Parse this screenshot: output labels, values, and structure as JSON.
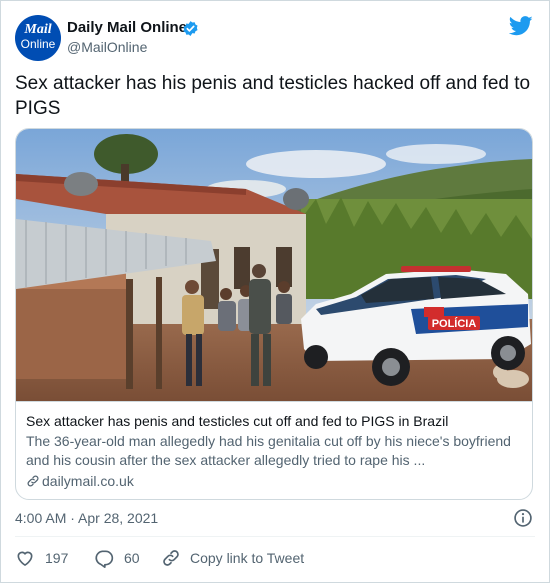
{
  "account": {
    "avatar_line1": "Mail",
    "avatar_line2": "Online",
    "name": "Daily Mail Online",
    "handle": "@MailOnline",
    "verified": true
  },
  "tweet": {
    "text": "Sex attacker has his penis and testicles hacked off and fed to PIGS",
    "timestamp": "4:00 AM · Apr 28, 2021"
  },
  "card": {
    "image_alt": "Police car parked outside a rural house with people standing on the veranda",
    "title": "Sex attacker has penis and testicles cut off and fed to PIGS in Brazil",
    "description": "The 36-year-old man allegedly had his genitalia cut off by his niece's boyfriend and his cousin after the sex attacker allegedly tried to rape his ...",
    "domain": "dailymail.co.uk",
    "police_text": "POLÍCIA"
  },
  "actions": {
    "likes": "197",
    "replies": "60",
    "copy_link": "Copy link to Tweet"
  },
  "colors": {
    "twitter_blue": "#1d9bf0",
    "brand_blue": "#004db3",
    "secondary_text": "#536471",
    "border": "#cfd9de"
  },
  "icons": [
    "verified-badge-icon",
    "twitter-bird-icon",
    "info-icon",
    "heart-icon",
    "reply-icon",
    "link-icon"
  ]
}
